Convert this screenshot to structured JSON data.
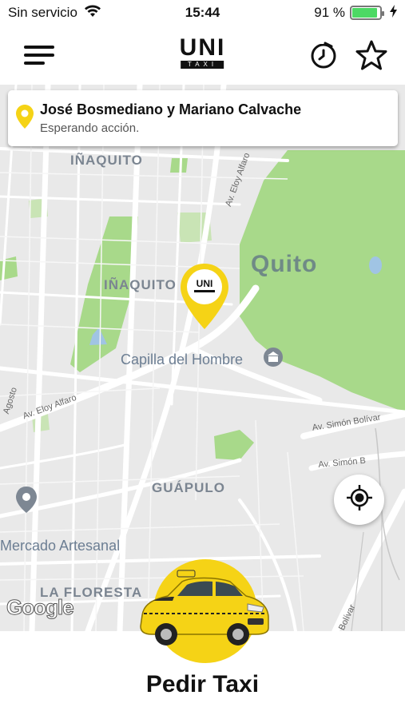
{
  "status_bar": {
    "carrier": "Sin servicio",
    "time": "15:44",
    "battery_percent": "91 %",
    "battery_level": 0.91
  },
  "header": {
    "logo_text": "UNI",
    "logo_sub": "TAXI",
    "menu_icon": "hamburger-menu-icon",
    "history_icon": "clock-icon",
    "favorites_icon": "star-icon"
  },
  "address_card": {
    "title": "José Bosmediano y Mariano Calvache",
    "subtitle": "Esperando acción."
  },
  "map": {
    "labels": {
      "inaquito_top": "IÑAQUITO",
      "inaquito_mid": "IÑAQUITO",
      "quito": "Quito",
      "capilla": "Capilla del Hombre",
      "guapulo": "GUÁPULO",
      "mercado": "Mercado Artesanal",
      "floresta": "LA FLORESTA",
      "eloy_alfaro_1": "Av. Eloy Alfaro",
      "eloy_alfaro_2": "Av. Eloy Alfaro",
      "simon_bolivar_1": "Av. Simón Bolívar",
      "simon_bolivar_2": "Av. Simón B",
      "agosto": "Agosto",
      "bolivar": "Bolívar"
    },
    "google_attribution": "Google",
    "pin_logo": "UNI"
  },
  "action": {
    "pedir_taxi": "Pedir Taxi"
  },
  "colors": {
    "accent": "#f5d316",
    "park": "#a8d98a",
    "map_bg": "#e9e9e9"
  }
}
